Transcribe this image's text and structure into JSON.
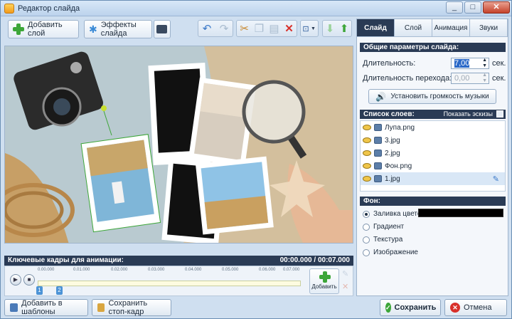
{
  "window": {
    "title": "Редактор слайда",
    "minimize": "_",
    "maximize": "□",
    "close": "✕"
  },
  "toolbar": {
    "add_layer": "Добавить слой",
    "slide_effects": "Эффекты слайда"
  },
  "timeline": {
    "header": "Ключевые кадры для анимации:",
    "time": "00:00.000 / 00:07.000",
    "ticks": [
      "0.00.000",
      "0.01.000",
      "0.02.000",
      "0.03.000",
      "0.04.000",
      "0.05.000",
      "0.06.000",
      "0.07.000"
    ],
    "keyframes": [
      "1",
      "2"
    ],
    "add_label": "Добавить"
  },
  "tabs": [
    "Слайд",
    "Слой",
    "Анимация",
    "Звуки"
  ],
  "slide_params": {
    "header": "Общие параметры слайда:",
    "duration_label": "Длительность:",
    "duration_value": "7,00",
    "transition_label": "Длительность перехода:",
    "transition_value": "0,00",
    "unit": "сек.",
    "volume_button": "Установить громкость музыки"
  },
  "layers": {
    "header": "Список слоев:",
    "thumbs_label": "Показать эскизы",
    "items": [
      "Лупа.png",
      "3.jpg",
      "2.jpg",
      "Фон.png",
      "1.jpg"
    ]
  },
  "background": {
    "header": "Фон:",
    "options": [
      "Заливка цветом",
      "Градиент",
      "Текстура",
      "Изображение"
    ],
    "fill_color": "#000000"
  },
  "footer": {
    "add_to_templates": "Добавить в шаблоны",
    "save_frame": "Сохранить стоп-кадр",
    "save": "Сохранить",
    "cancel": "Отмена"
  }
}
